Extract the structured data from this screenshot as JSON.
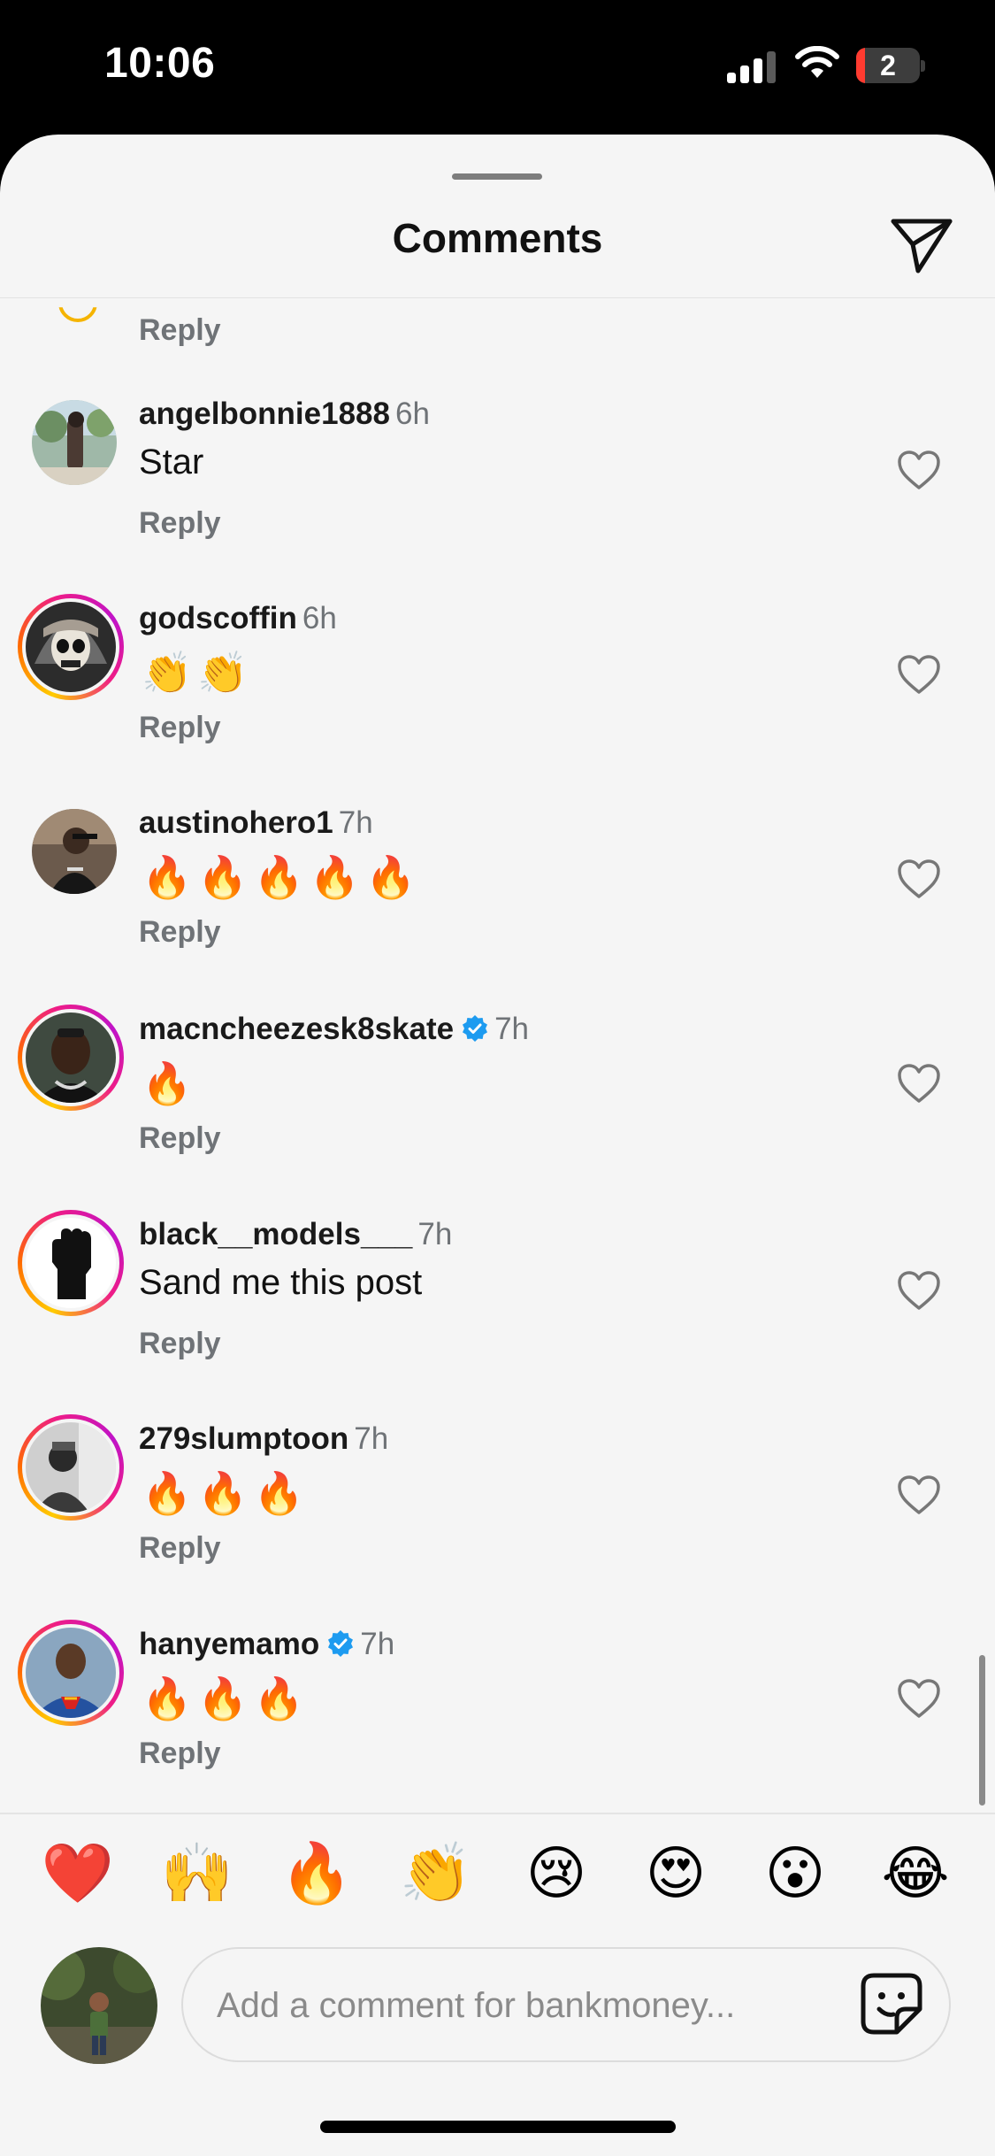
{
  "status_bar": {
    "time": "10:06",
    "battery_level": "2",
    "signal_bars": 3,
    "wifi": true
  },
  "header": {
    "title": "Comments",
    "share_icon": "paper-plane-icon"
  },
  "reply_label": "Reply",
  "comments": [
    {
      "username": "angelbonnie1888",
      "time": "6h",
      "text": "Star",
      "verified": false,
      "story_ring": false
    },
    {
      "username": "godscoffin",
      "time": "6h",
      "text": "👏👏",
      "verified": false,
      "story_ring": true
    },
    {
      "username": "austinohero1",
      "time": "7h",
      "text": "🔥🔥🔥🔥🔥",
      "verified": false,
      "story_ring": false
    },
    {
      "username": "macncheezesk8skate",
      "time": "7h",
      "text": "🔥",
      "verified": true,
      "story_ring": true
    },
    {
      "username": "black__models___",
      "time": "7h",
      "text": "Sand me this post",
      "verified": false,
      "story_ring": true
    },
    {
      "username": "279slumptoon",
      "time": "7h",
      "text": "🔥🔥🔥",
      "verified": false,
      "story_ring": true
    },
    {
      "username": "hanyemamo",
      "time": "7h",
      "text": "🔥🔥🔥",
      "verified": true,
      "story_ring": true
    }
  ],
  "quick_reactions": [
    "❤️",
    "🙌",
    "🔥",
    "👏",
    "😢",
    "😍",
    "😮",
    "😂"
  ],
  "composer": {
    "placeholder": "Add a comment for bankmoney...",
    "value": "",
    "sticker_icon": "sticker-icon"
  },
  "colors": {
    "verified": "#1d9bf0",
    "story_ring_start": "#ffcb00",
    "story_ring_end": "#c013c8",
    "secondary_text": "#6f7377"
  }
}
